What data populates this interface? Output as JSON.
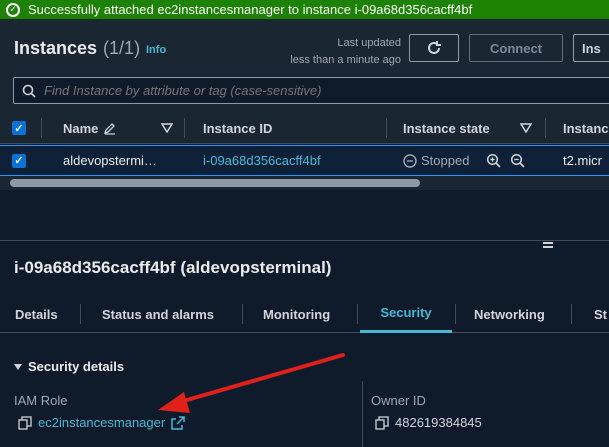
{
  "flash": {
    "message": "Successfully attached ec2instancesmanager to instance i-09a68d356cacff4bf"
  },
  "header": {
    "title": "Instances",
    "count": "(1/1)",
    "info": "Info",
    "last_updated_line1": "Last updated",
    "last_updated_line2": "less than a minute ago",
    "connect_label": "Connect",
    "inspect_label": "Ins"
  },
  "search": {
    "placeholder": "Find Instance by attribute or tag (case-sensitive)"
  },
  "table": {
    "columns": [
      "Name",
      "Instance ID",
      "Instance state",
      "Instanc"
    ],
    "row": {
      "name": "aldevopstermi…",
      "instance_id": "i-09a68d356cacff4bf",
      "state": "Stopped",
      "type": "t2.micr"
    }
  },
  "details": {
    "title": "i-09a68d356cacff4bf (aldevopsterminal)",
    "tabs": [
      "Details",
      "Status and alarms",
      "Monitoring",
      "Security",
      "Networking",
      "St"
    ],
    "active_tab": "Security",
    "section": "Security details",
    "iam_role_label": "IAM Role",
    "iam_role_value": "ec2instancesmanager",
    "owner_id_label": "Owner ID",
    "owner_id_value": "482619384845"
  },
  "colors": {
    "flash_bg": "#1d8102",
    "link": "#44b9d6",
    "selected_border": "#2c95ff",
    "checkbox": "#0972d3",
    "annotation_arrow": "#e0201b"
  }
}
